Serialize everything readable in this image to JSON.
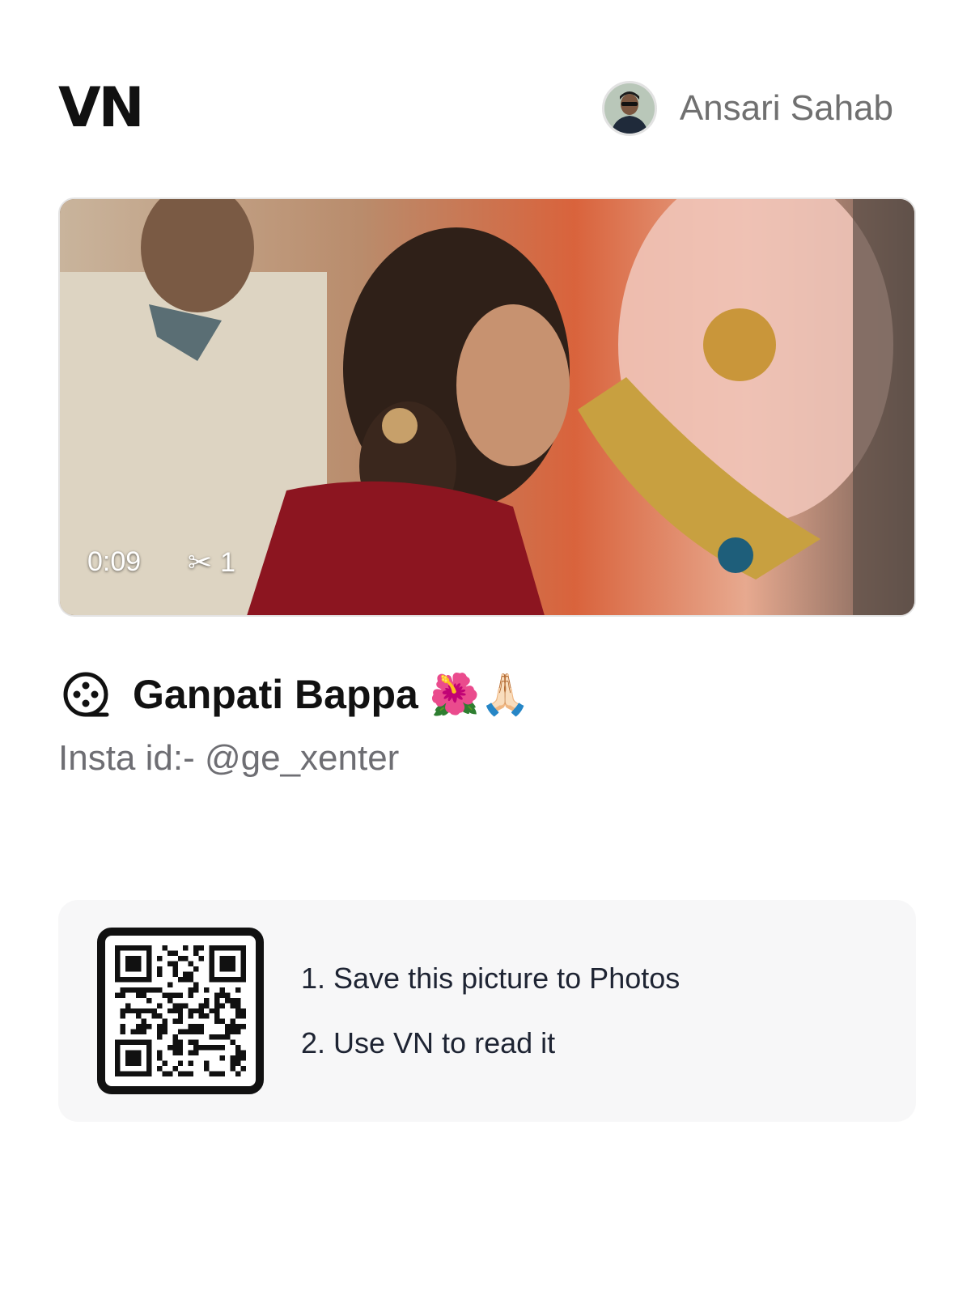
{
  "header": {
    "logo_text": "VN",
    "user_name": "Ansari Sahab"
  },
  "video": {
    "duration": "0:09",
    "clip_count": "1"
  },
  "project": {
    "title": "Ganpati Bappa 🌺🙏🏻",
    "description": "Insta id:- @ge_xenter"
  },
  "qr_card": {
    "step1": "1. Save this picture to Photos",
    "step2": "2. Use VN to read it"
  },
  "icons": {
    "scissors": "scissors-icon",
    "film": "film-reel-icon",
    "qr": "qr-code-icon"
  }
}
